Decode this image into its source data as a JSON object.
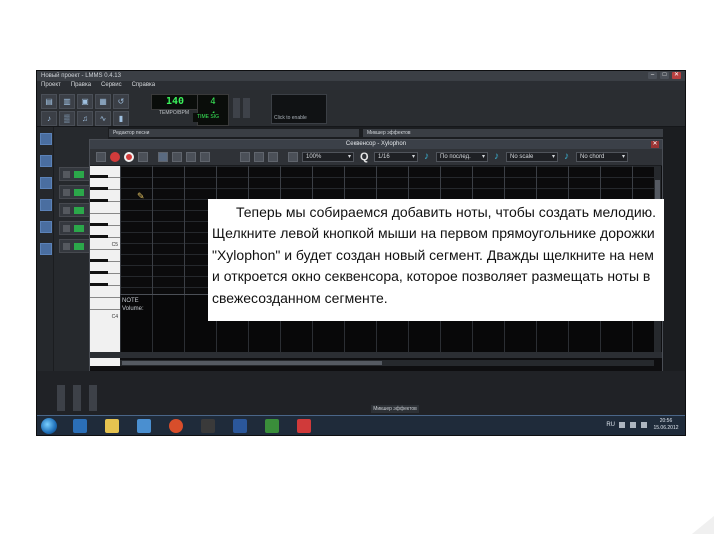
{
  "window": {
    "title": "Новый проект - LMMS 0.4.13",
    "minimize_label": "–",
    "maximize_label": "□",
    "close_label": "✕"
  },
  "menu": [
    "Проект",
    "Правка",
    "Сервис",
    "Справка"
  ],
  "toolbar": {
    "buttons": [
      "new-file-icon",
      "open-file-icon",
      "save-icon",
      "export-icon",
      "undo-icon"
    ],
    "tempo_lcd": "140",
    "timesig_numerator": "4",
    "timesig_denominator": "4",
    "tempo_caption": "TEMPO/BPM",
    "time_lcd": "TIME SIG",
    "osc_caption": "Click to enable"
  },
  "panels": {
    "song_editor_title": "Редактор песни",
    "fx_mixer_title": "Микшер эффектов"
  },
  "sequencer": {
    "title": "Секвенсор - Xylophon",
    "zoom_value": "100%",
    "quantize_label": "Q",
    "quantize_value": "1/16",
    "note_length_value": "По послед.",
    "scale_value": "No scale",
    "chord_value": "No chord",
    "octave_label_c5": "C5",
    "octave_label_c4": "C4",
    "note_panel_label_1": "NOTE",
    "note_panel_label_2": "Volume:"
  },
  "mixer": {
    "bottom_label": "Микшер эффектов"
  },
  "taskbar": {
    "lang": "RU",
    "time": "20:56",
    "date": "15.06.2012"
  },
  "caption": {
    "text": "Теперь мы собираемся добавить ноты, чтобы создать мелодию. Щелкните левой кнопкой мыши на первом прямоугольнике дорожки \"Xylophon\" и будет создан новый сегмент. Дважды щелкните на нем и откроется окно секвенсора, которое позволяет размещать ноты в свежесозданном сегменте."
  },
  "colors": {
    "lcd_green": "#3af05a",
    "rec_red": "#d13b3b",
    "accent_blue": "#3ab0d0"
  }
}
